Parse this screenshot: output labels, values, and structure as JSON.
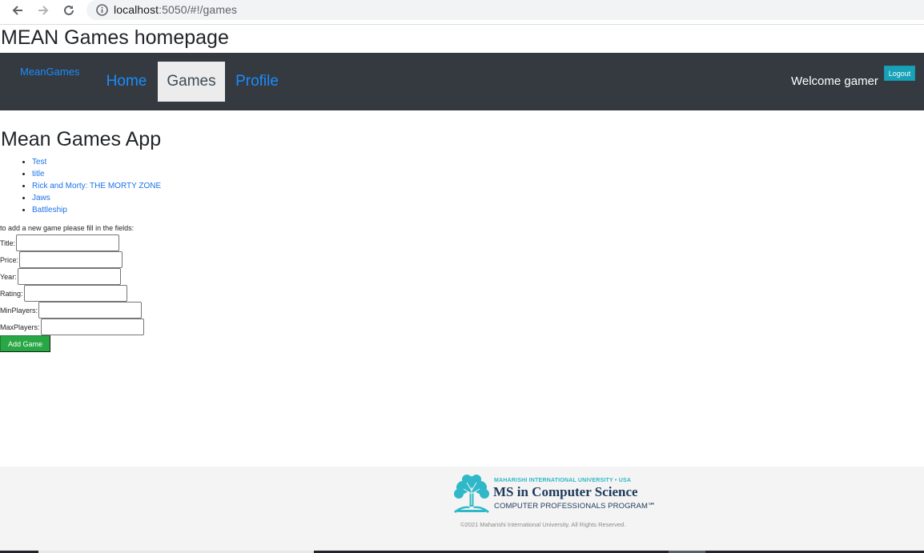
{
  "browser": {
    "url_host": "localhost",
    "url_path": ":5050/#!/games",
    "icons": {
      "back": "arrow-left-icon",
      "forward": "arrow-right-icon",
      "reload": "reload-icon",
      "info": "info-icon"
    }
  },
  "page": {
    "heading": "MEAN Games homepage"
  },
  "navbar": {
    "brand": "MeanGames",
    "links": [
      {
        "label": "Home",
        "active": false
      },
      {
        "label": "Games",
        "active": true
      },
      {
        "label": "Profile",
        "active": false
      }
    ],
    "welcome": "Welcome gamer",
    "logout_label": "Logout",
    "colors": {
      "background": "#343a40",
      "link": "#1a8cff",
      "logout": "#17a2b8"
    }
  },
  "main": {
    "title": "Mean Games App",
    "games": [
      "Test",
      "title",
      "Rick and Morty: THE MORTY ZONE",
      "Jaws",
      "Battleship"
    ],
    "form_intro": "to add a new game please fill in the fields:",
    "fields": {
      "title": {
        "label": "Title:",
        "value": ""
      },
      "price": {
        "label": "Price:",
        "value": ""
      },
      "year": {
        "label": "Year:",
        "value": ""
      },
      "rating": {
        "label": "Rating:",
        "value": ""
      },
      "minplayers": {
        "label": "MinPlayers:",
        "value": ""
      },
      "maxplayers": {
        "label": "MaxPlayers:",
        "value": ""
      }
    },
    "add_button_label": "Add Game",
    "add_button_color": "#28a745"
  },
  "footer": {
    "logo_line1": "MAHARISHI INTERNATIONAL UNIVERSITY • USA",
    "logo_line2": "MS in Computer Science",
    "logo_line3": "COMPUTER PROFESSIONALS PROGRAM℠",
    "logo_icon": "tree-icon",
    "copyright": "©2021 Maharishi International University. All Rights Reserved."
  }
}
